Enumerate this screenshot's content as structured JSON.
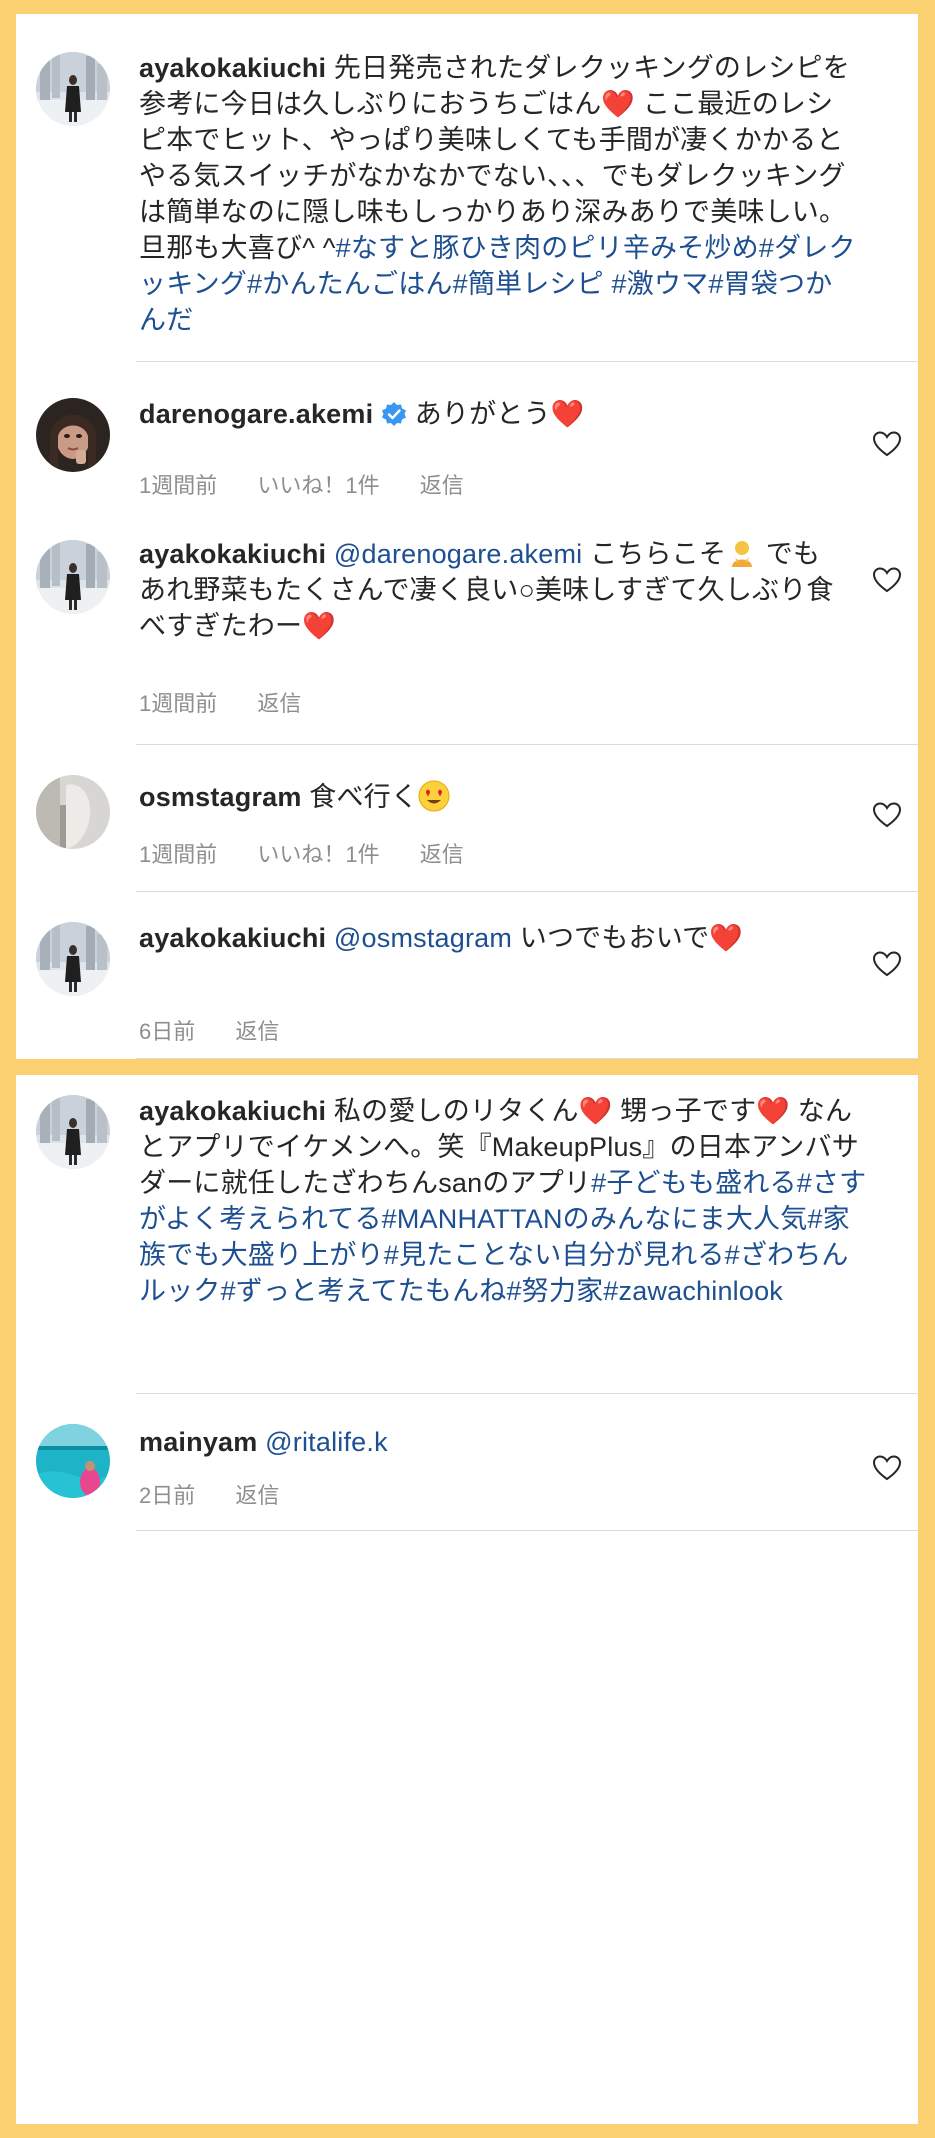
{
  "panel1": {
    "caption": {
      "username": "ayakokakiuchi",
      "text": "先日発売されたダレクッキングのレシピを参考に今日は久しぶりにおうちごはん",
      "heart": "❤️",
      "text2": "ここ最近のレシピ本でヒット、やっぱり美味しくても手間が凄くかかるとやる気スイッチがなかなかでない、、、でもダレクッキングは簡単なのに隠し味もしっかりあり深みありで美味しい。旦那も大喜び^ ^",
      "hashtags": "#なすと豚ひき肉のピリ辛みそ炒め#ダレクッキング#かんたんごはん#簡単レシピ #激ウマ#胃袋つかんだ"
    },
    "comments": [
      {
        "username": "darenogare.akemi",
        "text": "ありがとう",
        "heart": "❤️",
        "time": "1週間前",
        "likes": "いいね！1件",
        "reply": "返信"
      },
      {
        "username": "ayakokakiuchi",
        "mention": "@darenogare.akemi",
        "text1": "こちらこそ",
        "text2": "でもあれ野菜もたくさんで凄く良い○美味しすぎて久しぶり食べすぎたわー",
        "heart": "❤️",
        "time": "1週間前",
        "reply": "返信"
      },
      {
        "username": "osmstagram",
        "text": "食べ行く",
        "time": "1週間前",
        "likes": "いいね！1件",
        "reply": "返信"
      },
      {
        "username": "ayakokakiuchi",
        "mention": "@osmstagram",
        "text": "いつでもおいで",
        "heart": "❤️",
        "time": "6日前",
        "reply": "返信"
      }
    ]
  },
  "panel2": {
    "caption": {
      "username": "ayakokakiuchi",
      "text1": "私の愛しのリタくん",
      "heart": "❤️",
      "text2": "甥っ子です",
      "text3": "なんとアプリでイケメンへ。笑『MakeupPlus』の日本アンバサダーに就任したざわちんsanのアプリ",
      "hashtags": "#子どもも盛れる#さすがよく考えられてる#MANHATTANのみんなにま大人気#家族でも大盛り上がり#見たことない自分が見れる#ざわちんルック#ずっと考えてたもんね#努力家#zawachinlook"
    },
    "comments": [
      {
        "username": "mainyam",
        "mention": "@ritalife.k",
        "time": "2日前",
        "reply": "返信"
      }
    ]
  },
  "colors": {
    "background": "#fbd070",
    "link": "#1d4f91",
    "meta": "#8e8e8e",
    "heart_emoji": "#e0212b"
  },
  "icons": {
    "like": "heart-outline-icon",
    "verified": "verified-badge-icon"
  }
}
